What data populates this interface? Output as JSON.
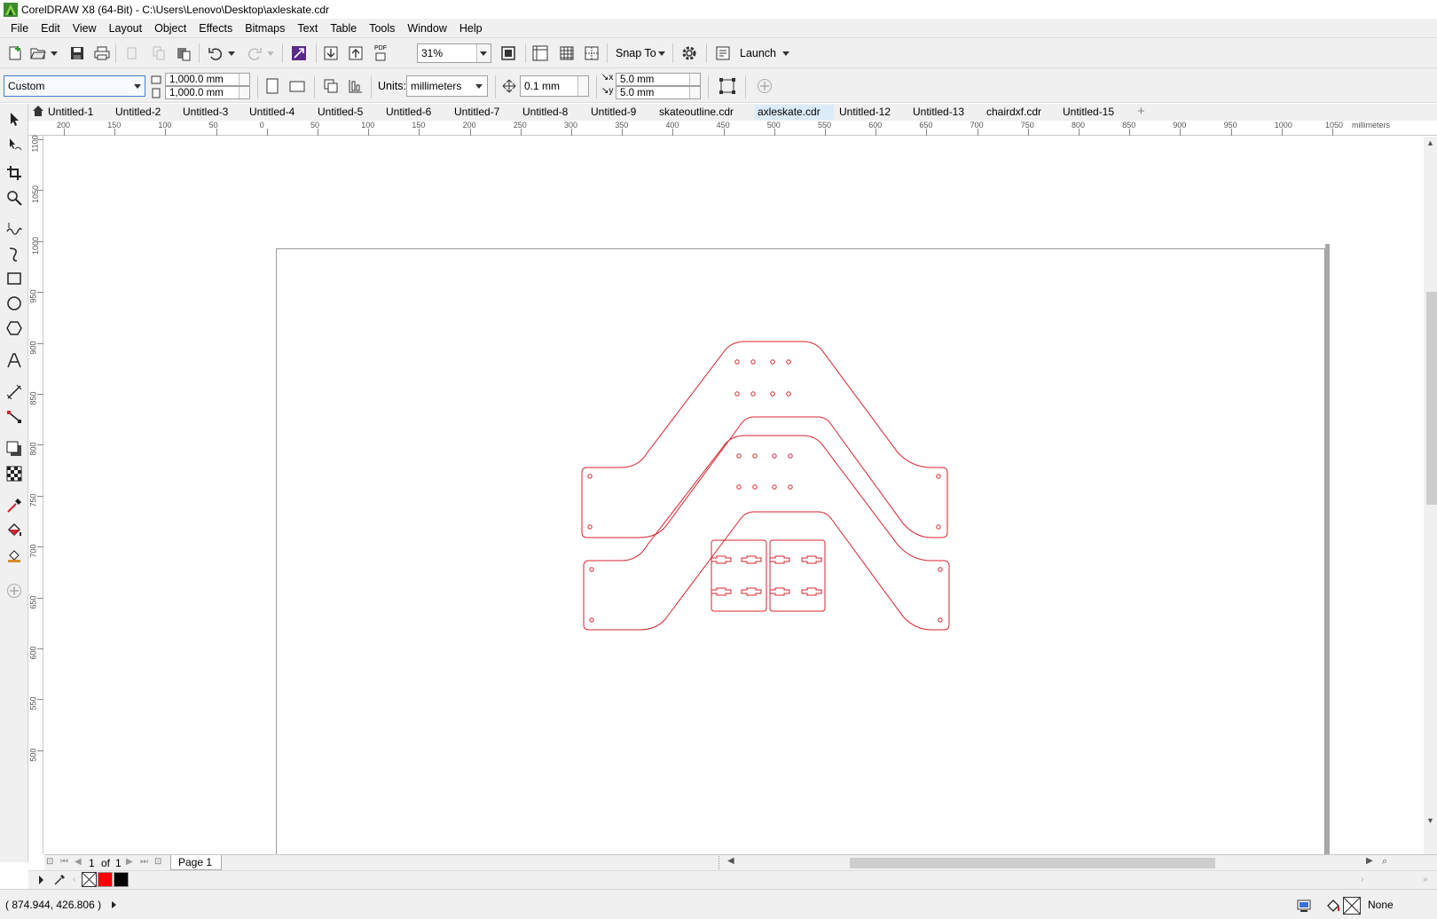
{
  "window": {
    "title": "CorelDRAW X8 (64-Bit) - C:\\Users\\Lenovo\\Desktop\\axleskate.cdr"
  },
  "menu": [
    "File",
    "Edit",
    "View",
    "Layout",
    "Object",
    "Effects",
    "Bitmaps",
    "Text",
    "Table",
    "Tools",
    "Window",
    "Help"
  ],
  "toolbar": {
    "zoom": "31%",
    "snap_to": "Snap To",
    "launch": "Launch",
    "pdf_label": "PDF"
  },
  "property_bar": {
    "page_preset": "Custom",
    "width": "1,000.0 mm",
    "height": "1,000.0 mm",
    "units_label": "Units:",
    "units_value": "millimeters",
    "nudge": "0.1 mm",
    "dup_x": "5.0 mm",
    "dup_y": "5.0 mm"
  },
  "tabs": [
    {
      "label": "Untitled-1"
    },
    {
      "label": "Untitled-2"
    },
    {
      "label": "Untitled-3"
    },
    {
      "label": "Untitled-4"
    },
    {
      "label": "Untitled-5"
    },
    {
      "label": "Untitled-6"
    },
    {
      "label": "Untitled-7"
    },
    {
      "label": "Untitled-8"
    },
    {
      "label": "Untitled-9"
    },
    {
      "label": "skateoutline.cdr"
    },
    {
      "label": "axleskate.cdr",
      "active": true
    },
    {
      "label": "Untitled-12"
    },
    {
      "label": "Untitled-13"
    },
    {
      "label": "chairdxf.cdr"
    },
    {
      "label": "Untitled-15"
    }
  ],
  "ruler": {
    "h_ticks": [
      "200",
      "150",
      "100",
      "50",
      "0",
      "50",
      "100",
      "150",
      "200",
      "250",
      "300",
      "350",
      "400",
      "450",
      "500",
      "550",
      "600",
      "650",
      "700",
      "750",
      "800",
      "850",
      "900",
      "950",
      "1000",
      "1050"
    ],
    "h_unit": "millimeters",
    "v_ticks": [
      "1100",
      "1050",
      "1000",
      "950",
      "900",
      "850",
      "800",
      "750",
      "700",
      "650",
      "600",
      "550",
      "500"
    ]
  },
  "page_nav": {
    "current": "1",
    "of_label": "of",
    "total": "1",
    "page_tab": "Page 1"
  },
  "status": {
    "coordinates": "( 874.944, 426.806 )",
    "fill": "None"
  },
  "colors": {
    "outline": "#d5242e",
    "palette": [
      "none",
      "#ff0000",
      "#000000"
    ]
  }
}
